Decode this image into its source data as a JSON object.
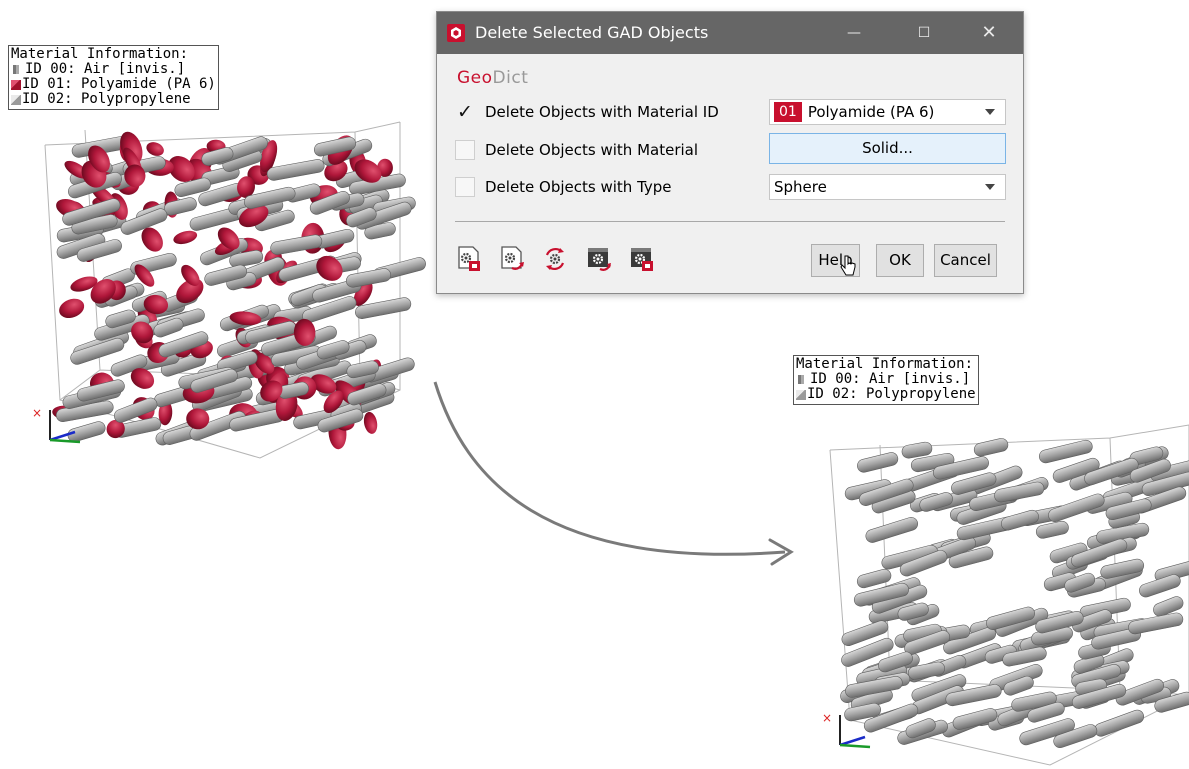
{
  "legend_before": {
    "title": "Material Information:",
    "items": [
      {
        "label": "ID 00: Air [invis.]",
        "swatch": "air"
      },
      {
        "label": "ID 01: Polyamide (PA 6)",
        "swatch": "pa"
      },
      {
        "label": "ID 02: Polypropylene",
        "swatch": "pp"
      }
    ]
  },
  "legend_after": {
    "title": "Material Information:",
    "items": [
      {
        "label": "ID 00: Air [invis.]",
        "swatch": "air"
      },
      {
        "label": "ID 02: Polypropylene",
        "swatch": "pp"
      }
    ]
  },
  "dialog": {
    "title": "Delete Selected GAD Objects",
    "brand_geo": "Geo",
    "brand_dict": "Dict",
    "options": [
      {
        "label": "Delete Objects with Material ID",
        "checked": true
      },
      {
        "label": "Delete Objects with Material",
        "checked": false
      },
      {
        "label": "Delete Objects with Type",
        "checked": false
      }
    ],
    "material_id_combo": {
      "badge": "01",
      "value": "Polyamide (PA 6)"
    },
    "material_button": "Solid...",
    "type_combo": "Sphere",
    "buttons": {
      "help": "Help",
      "ok": "OK",
      "cancel": "Cancel"
    },
    "checkmark": "✓",
    "window_controls": {
      "minimize": "—",
      "maximize": "☐",
      "close": "✕"
    },
    "toolbar_icons": [
      "gear-lock-icon",
      "gear-arrow-icon",
      "gear-refresh-icon",
      "gear-export-icon",
      "gear-save-icon"
    ]
  },
  "colors": {
    "accent_red": "#c8102e",
    "polyamide": "#b0173a",
    "polypropylene": "#9a9a9a",
    "titlebar": "#666666"
  }
}
